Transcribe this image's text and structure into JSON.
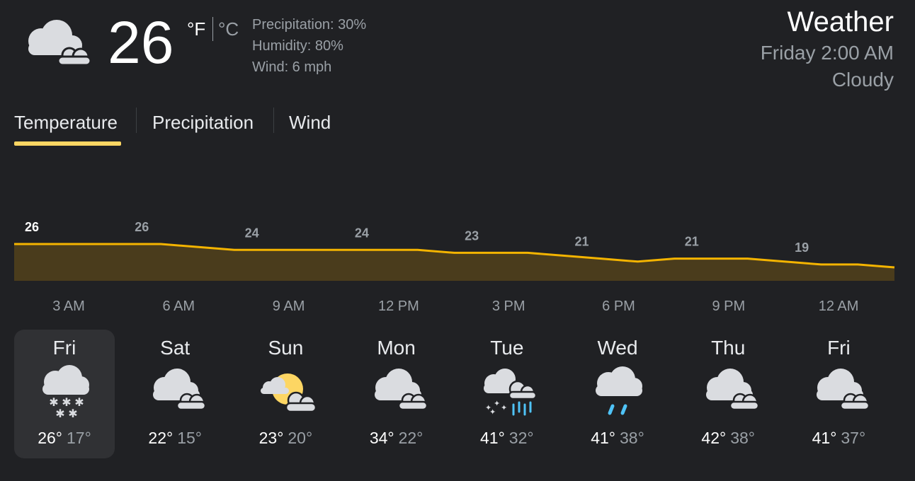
{
  "current": {
    "icon": "cloudy-icon",
    "temperature": "26",
    "unit_f": "°F",
    "unit_c": "°C",
    "selected_unit": "°F",
    "precipitation": "Precipitation: 30%",
    "humidity": "Humidity: 80%",
    "wind": "Wind: 6 mph"
  },
  "header": {
    "title": "Weather",
    "datetime": "Friday 2:00 AM",
    "condition": "Cloudy"
  },
  "tabs": [
    {
      "label": "Temperature",
      "selected": true
    },
    {
      "label": "Precipitation",
      "selected": false
    },
    {
      "label": "Wind",
      "selected": false
    }
  ],
  "colors": {
    "accent": "#fdd663",
    "line": "#f4b400",
    "area": "#4a3c1c",
    "background": "#202124"
  },
  "chart_data": {
    "type": "area",
    "x": [
      "2 AM",
      "3 AM",
      "4 AM",
      "5 AM",
      "6 AM",
      "7 AM",
      "8 AM",
      "9 AM",
      "10 AM",
      "11 AM",
      "12 PM",
      "1 PM",
      "2 PM",
      "3 PM",
      "4 PM",
      "5 PM",
      "6 PM",
      "7 PM",
      "8 PM",
      "9 PM",
      "10 PM",
      "11 PM",
      "12 AM",
      "1 AM",
      "2 AM"
    ],
    "values": [
      26,
      26,
      26,
      26,
      26,
      25,
      24,
      24,
      24,
      24,
      24,
      24,
      23,
      23,
      23,
      22,
      21,
      20,
      21,
      21,
      21,
      20,
      19,
      19,
      18
    ],
    "point_labels": [
      {
        "x": "3 AM",
        "value": "26"
      },
      {
        "x": "6 AM",
        "value": "26"
      },
      {
        "x": "9 AM",
        "value": "24"
      },
      {
        "x": "12 PM",
        "value": "24"
      },
      {
        "x": "3 PM",
        "value": "23"
      },
      {
        "x": "6 PM",
        "value": "21"
      },
      {
        "x": "9 PM",
        "value": "21"
      },
      {
        "x": "12 AM",
        "value": "19"
      }
    ],
    "tick_labels": [
      "3 AM",
      "6 AM",
      "9 AM",
      "12 PM",
      "3 PM",
      "6 PM",
      "9 PM",
      "12 AM"
    ]
  },
  "forecast": [
    {
      "day": "Fri",
      "icon": "snow-icon",
      "high": "26°",
      "low": "17°",
      "selected": true
    },
    {
      "day": "Sat",
      "icon": "cloudy-icon",
      "high": "22°",
      "low": "15°",
      "selected": false
    },
    {
      "day": "Sun",
      "icon": "partly-cloudy-night-icon",
      "high": "23°",
      "low": "20°",
      "selected": false
    },
    {
      "day": "Mon",
      "icon": "cloudy-icon",
      "high": "34°",
      "low": "22°",
      "selected": false
    },
    {
      "day": "Tue",
      "icon": "snow-rain-icon",
      "high": "41°",
      "low": "32°",
      "selected": false
    },
    {
      "day": "Wed",
      "icon": "rain-icon",
      "high": "41°",
      "low": "38°",
      "selected": false
    },
    {
      "day": "Thu",
      "icon": "cloudy-icon",
      "high": "42°",
      "low": "38°",
      "selected": false
    },
    {
      "day": "Fri",
      "icon": "cloudy-icon",
      "high": "41°",
      "low": "37°",
      "selected": false
    }
  ]
}
